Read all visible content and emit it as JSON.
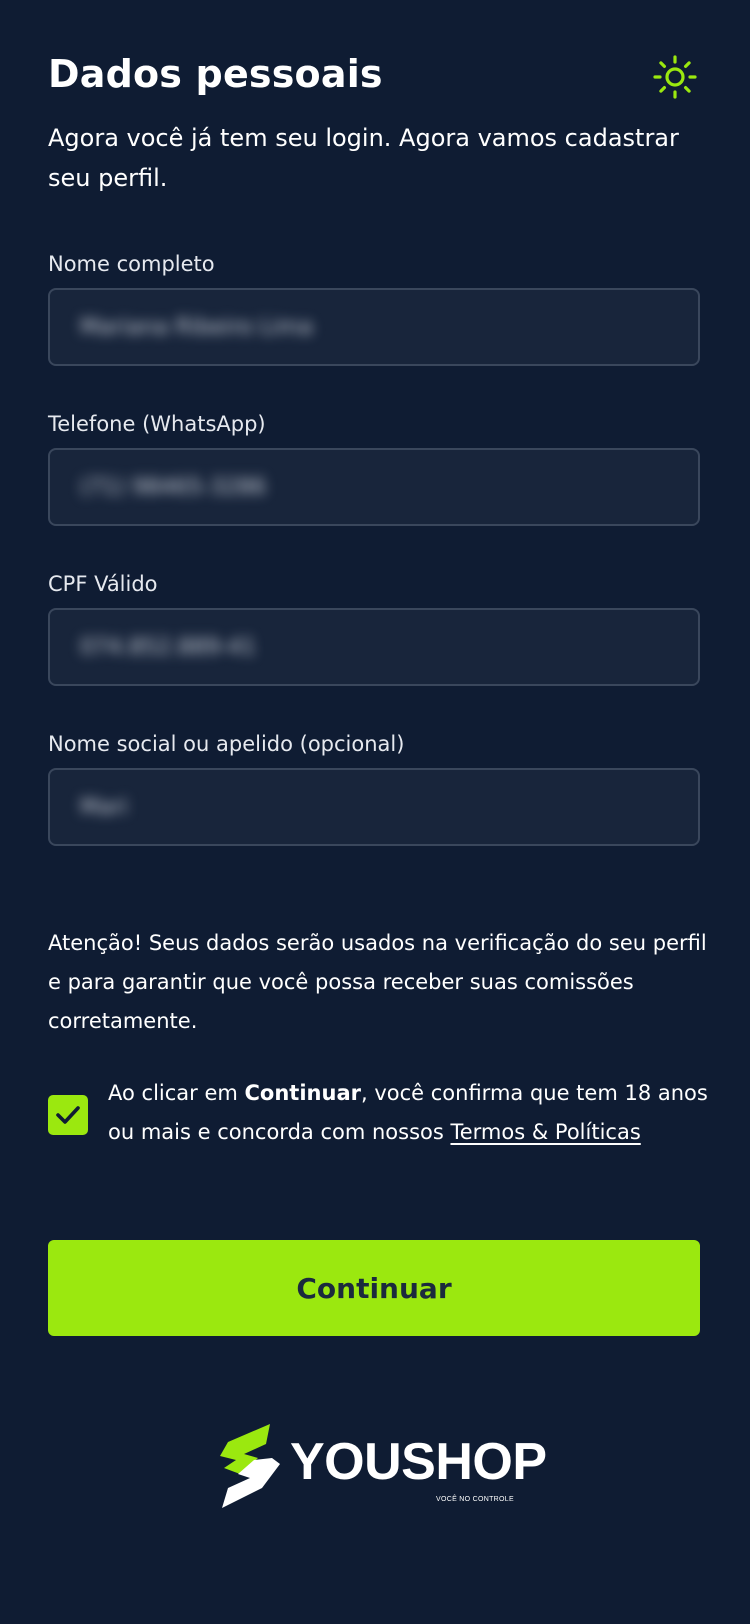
{
  "header": {
    "title": "Dados pessoais",
    "theme_toggle_icon": "sun-icon",
    "subtitle": "Agora você já tem seu login. Agora vamos cadastrar seu perfil."
  },
  "form": {
    "fields": [
      {
        "label": "Nome completo",
        "value": "Mariana Ribeiro Lima"
      },
      {
        "label": "Telefone (WhatsApp)",
        "value": "(71) 98465-3286"
      },
      {
        "label": "CPF Válido",
        "value": "074.852.889-41"
      },
      {
        "label": "Nome social ou apelido (opcional)",
        "value": "Mari"
      }
    ]
  },
  "notice": "Atenção! Seus dados serão usados na verificação do seu perfil e para garantir que você possa receber suas comissões corretamente.",
  "consent": {
    "checked": true,
    "prefix": "Ao clicar em ",
    "bold": "Continuar",
    "middle": ", você confirma que tem 18 anos ou mais e concorda com nossos ",
    "link": "Termos & Políticas"
  },
  "continue_label": "Continuar",
  "brand": {
    "name": "YOUSHOP",
    "tagline": "VOCÊ NO CONTROLE"
  },
  "colors": {
    "background": "#0f1c33",
    "accent": "#9be80f",
    "input_background": "#18253b",
    "input_border": "#3a475c",
    "button_text": "#1b2a3d"
  }
}
